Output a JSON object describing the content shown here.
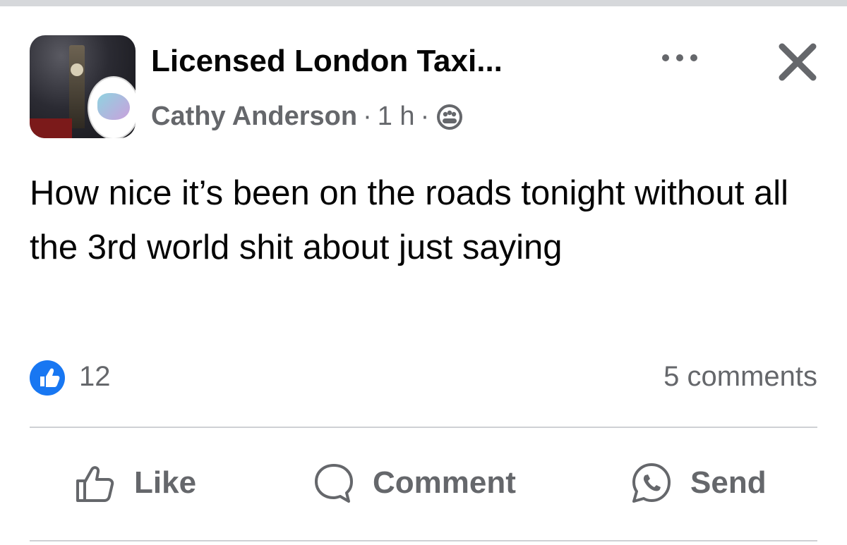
{
  "post": {
    "group_name": "Licensed London Taxi...",
    "author": "Cathy Anderson",
    "separator": "·",
    "time": "1 h",
    "audience_icon": "group-members-icon",
    "text": "How nice it’s been on the roads tonight without all the 3rd world shit about just saying"
  },
  "stats": {
    "like_count": "12",
    "comments": "5 comments"
  },
  "actions": {
    "like_label": "Like",
    "comment_label": "Comment",
    "send_label": "Send"
  },
  "colors": {
    "like_blue": "#1877f2",
    "secondary_text": "#65676b",
    "divider": "#ced0d4"
  }
}
